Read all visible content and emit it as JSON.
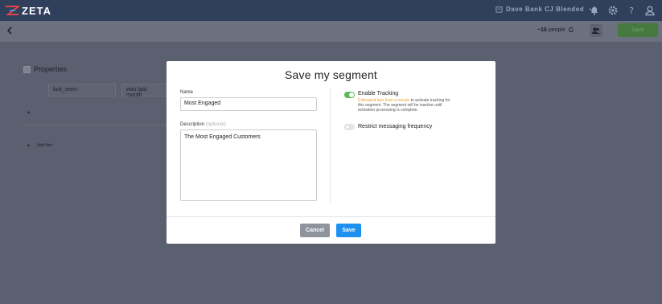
{
  "app": {
    "logo_text": "ZETA"
  },
  "topnav": {
    "account_name": "Dave Bank CJ Blended",
    "icons": [
      "bell-icon",
      "gear-icon",
      "help-icon",
      "user-icon"
    ]
  },
  "subbar": {
    "people_count": "~16",
    "people_label": "people",
    "save_label": "Save"
  },
  "background": {
    "section_title": "Properties",
    "field_select": "last_seen",
    "operator_select": "was last month",
    "add_filter_label": "Add filter"
  },
  "modal": {
    "title": "Save my segment",
    "name_label": "Name",
    "name_value": "Most Engaged",
    "description_label": "Description",
    "description_optional": "(optional)",
    "description_value": "The Most Engaged Customers",
    "enable_tracking_label": "Enable Tracking",
    "tracking_help_warn": "Estimated less than a minute",
    "tracking_help_rest": " to activate tracking for this segment. The segment will be inactive until activation processing is complete.",
    "enable_tracking_on": true,
    "restrict_label": "Restrict messaging frequency",
    "restrict_on": false,
    "cancel_label": "Cancel",
    "save_label": "Save"
  },
  "colors": {
    "nav_bg": "#2f3f5c",
    "primary_button": "#1e90f0",
    "toggle_on": "#5cb85c",
    "warning_text": "#e8a33c"
  }
}
